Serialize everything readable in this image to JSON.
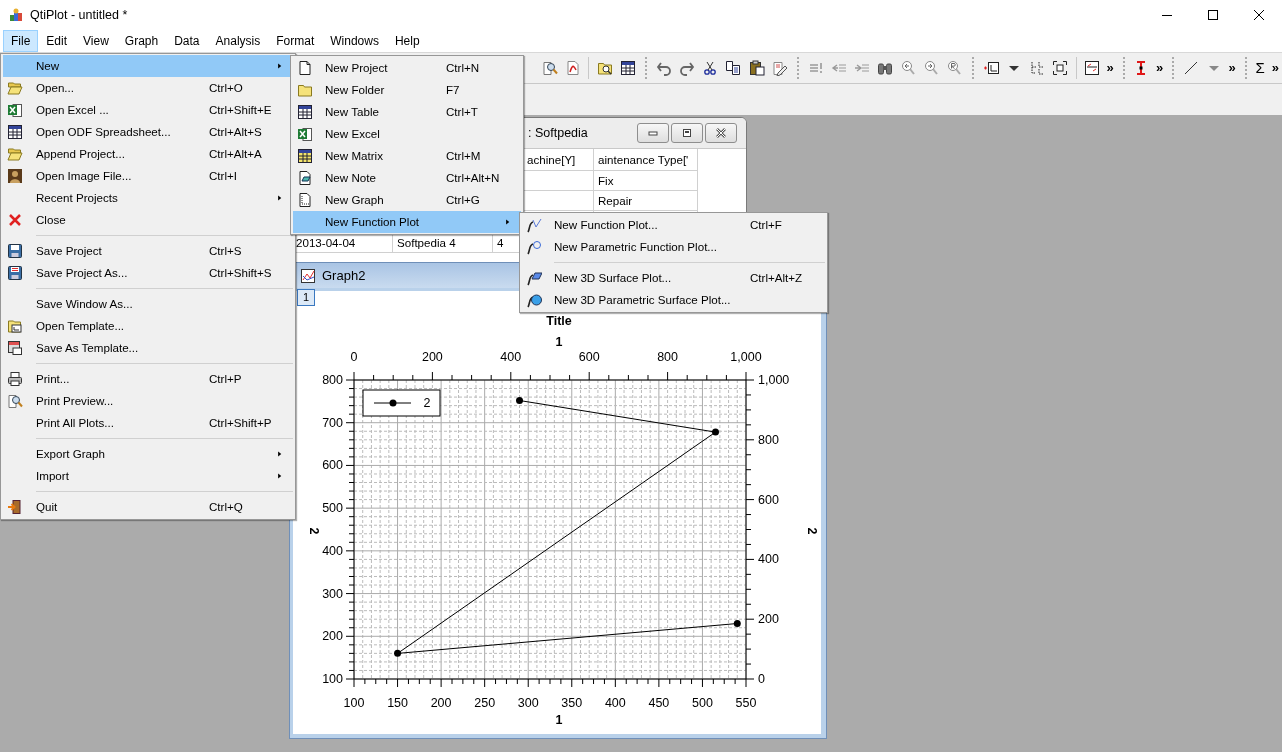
{
  "window": {
    "title": "QtiPlot - untitled *"
  },
  "menu_bar": [
    {
      "label": "File",
      "selected": true
    },
    {
      "label": "Edit",
      "selected": false
    },
    {
      "label": "View",
      "selected": false
    },
    {
      "label": "Graph",
      "selected": false
    },
    {
      "label": "Data",
      "selected": false
    },
    {
      "label": "Analysis",
      "selected": false
    },
    {
      "label": "Format",
      "selected": false
    },
    {
      "label": "Windows",
      "selected": false
    },
    {
      "label": "Help",
      "selected": false
    }
  ],
  "toolbar": {
    "overflow": [
      "»",
      "»",
      "»",
      "»"
    ],
    "sum": "Σ"
  },
  "table_window": {
    "title": ": Softpedia",
    "header": {
      "column_3": "achine[Y]",
      "column_4": "aintenance Type['"
    },
    "rows": [
      {
        "column_4": "Fix"
      },
      {
        "column_4": "Repair"
      },
      {
        "column_1": "2013-04-04",
        "column_2": "Softpedia 4",
        "column_3": "4"
      }
    ]
  },
  "graph_window": {
    "title": "Graph2",
    "layer_button": "1",
    "top_axis": {
      "label": "1",
      "ticks": [
        "0",
        "200",
        "400",
        "600",
        "800",
        "1,000"
      ]
    },
    "right_axis": {
      "label": "2",
      "ticks": [
        "1,000",
        "800",
        "600",
        "400",
        "200",
        "0"
      ]
    },
    "chart_data": {
      "type": "line",
      "title": "Title",
      "xlabel": "1",
      "ylabel": "2",
      "x": [
        290,
        515,
        150,
        540
      ],
      "grid": true,
      "series": [
        {
          "name": "2",
          "color": "#000000",
          "marker": "circle",
          "values": [
            752,
            678,
            160,
            230
          ]
        }
      ],
      "xlim": [
        100,
        550
      ],
      "ylim": [
        100,
        800
      ],
      "xticks": [
        100,
        150,
        200,
        250,
        300,
        350,
        400,
        450,
        500,
        550
      ],
      "yticks": [
        100,
        200,
        300,
        400,
        500,
        600,
        700,
        800
      ]
    }
  },
  "file_menu": {
    "items": [
      {
        "kind": "item",
        "label": "New",
        "submenu": true,
        "selected": true
      },
      {
        "kind": "item",
        "label": "Open...",
        "shortcut": "Ctrl+O",
        "selected": false
      },
      {
        "kind": "item",
        "label": "Open Excel ...",
        "shortcut": "Ctrl+Shift+E",
        "selected": false
      },
      {
        "kind": "item",
        "label": "Open ODF Spreadsheet...",
        "shortcut": "Ctrl+Alt+S",
        "selected": false
      },
      {
        "kind": "item",
        "label": "Append Project...",
        "shortcut": "Ctrl+Alt+A",
        "selected": false
      },
      {
        "kind": "item",
        "label": "Open Image File...",
        "shortcut": "Ctrl+I",
        "selected": false
      },
      {
        "kind": "item",
        "label": "Recent Projects",
        "submenu": true,
        "selected": false
      },
      {
        "kind": "item",
        "label": "Close",
        "selected": false
      },
      {
        "kind": "separator"
      },
      {
        "kind": "item",
        "label": "Save Project",
        "shortcut": "Ctrl+S",
        "selected": false
      },
      {
        "kind": "item",
        "label": "Save Project As...",
        "shortcut": "Ctrl+Shift+S",
        "selected": false
      },
      {
        "kind": "separator"
      },
      {
        "kind": "item",
        "label": "Save Window As...",
        "selected": false
      },
      {
        "kind": "item",
        "label": "Open Template...",
        "selected": false
      },
      {
        "kind": "item",
        "label": "Save As Template...",
        "selected": false
      },
      {
        "kind": "separator"
      },
      {
        "kind": "item",
        "label": "Print...",
        "shortcut": "Ctrl+P",
        "selected": false
      },
      {
        "kind": "item",
        "label": "Print Preview...",
        "selected": false
      },
      {
        "kind": "item",
        "label": "Print All Plots...",
        "shortcut": "Ctrl+Shift+P",
        "selected": false
      },
      {
        "kind": "separator"
      },
      {
        "kind": "item",
        "label": "Export Graph",
        "submenu": true,
        "selected": false
      },
      {
        "kind": "item",
        "label": "Import",
        "submenu": true,
        "selected": false
      },
      {
        "kind": "separator"
      },
      {
        "kind": "item",
        "label": "Quit",
        "shortcut": "Ctrl+Q",
        "selected": false
      }
    ]
  },
  "new_menu": {
    "items": [
      {
        "kind": "item",
        "label": "New Project",
        "shortcut": "Ctrl+N",
        "selected": false
      },
      {
        "kind": "item",
        "label": "New Folder",
        "shortcut": "F7",
        "selected": false
      },
      {
        "kind": "item",
        "label": "New Table",
        "shortcut": "Ctrl+T",
        "selected": false
      },
      {
        "kind": "item",
        "label": "New Excel",
        "selected": false
      },
      {
        "kind": "item",
        "label": "New Matrix",
        "shortcut": "Ctrl+M",
        "selected": false
      },
      {
        "kind": "item",
        "label": "New Note",
        "shortcut": "Ctrl+Alt+N",
        "selected": false
      },
      {
        "kind": "item",
        "label": "New Graph",
        "shortcut": "Ctrl+G",
        "selected": false
      },
      {
        "kind": "item",
        "label": "New Function Plot",
        "submenu": true,
        "selected": true
      }
    ]
  },
  "function_plot_menu": {
    "items": [
      {
        "kind": "item",
        "label": "New Function Plot...",
        "shortcut": "Ctrl+F",
        "selected": false
      },
      {
        "kind": "item",
        "label": "New Parametric Function Plot...",
        "selected": false
      },
      {
        "kind": "separator"
      },
      {
        "kind": "item",
        "label": "New 3D Surface Plot...",
        "shortcut": "Ctrl+Alt+Z",
        "selected": false
      },
      {
        "kind": "item",
        "label": "New 3D Parametric Surface Plot...",
        "selected": false
      }
    ]
  }
}
